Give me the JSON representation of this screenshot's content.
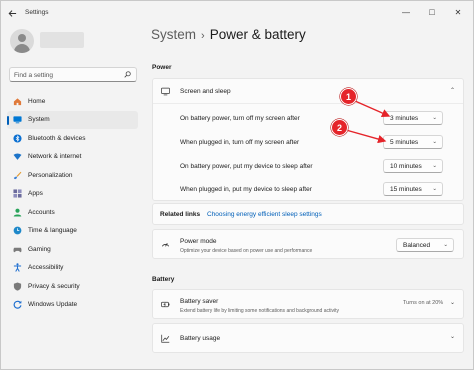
{
  "app": {
    "title": "Settings"
  },
  "window_controls": {
    "minimize": "—",
    "maximize": "□",
    "close": "✕"
  },
  "search": {
    "placeholder": "Find a setting"
  },
  "sidebar": {
    "items": [
      {
        "label": "Home",
        "icon": "home-icon",
        "color": "#e07a3a"
      },
      {
        "label": "System",
        "icon": "system-icon",
        "color": "#0078d4"
      },
      {
        "label": "Bluetooth & devices",
        "icon": "bluetooth-icon",
        "color": "#0a6fd1"
      },
      {
        "label": "Network & internet",
        "icon": "wifi-icon",
        "color": "#1d74c9"
      },
      {
        "label": "Personalization",
        "icon": "brush-icon",
        "color": "#e39b32"
      },
      {
        "label": "Apps",
        "icon": "apps-icon",
        "color": "#6b6b9c"
      },
      {
        "label": "Accounts",
        "icon": "accounts-icon",
        "color": "#28a35a"
      },
      {
        "label": "Time & language",
        "icon": "globe-clock-icon",
        "color": "#1e88c9"
      },
      {
        "label": "Gaming",
        "icon": "gaming-icon",
        "color": "#7a7a7a"
      },
      {
        "label": "Accessibility",
        "icon": "accessibility-icon",
        "color": "#1f6fd0"
      },
      {
        "label": "Privacy & security",
        "icon": "shield-icon",
        "color": "#7a7a7a"
      },
      {
        "label": "Windows Update",
        "icon": "update-icon",
        "color": "#1e6fd0"
      }
    ]
  },
  "breadcrumb": {
    "parent": "System",
    "separator": "›",
    "current": "Power & battery"
  },
  "power": {
    "section_label": "Power",
    "screen_sleep": {
      "title": "Screen and sleep",
      "rows": [
        {
          "label": "On battery power, turn off my screen after",
          "value": "3 minutes"
        },
        {
          "label": "When plugged in, turn off my screen after",
          "value": "5 minutes"
        },
        {
          "label": "On battery power, put my device to sleep after",
          "value": "10 minutes"
        },
        {
          "label": "When plugged in, put my device to sleep after",
          "value": "15 minutes"
        }
      ]
    },
    "related": {
      "label": "Related links",
      "link": "Choosing energy efficient sleep settings"
    },
    "power_mode": {
      "title": "Power mode",
      "desc": "Optimize your device based on power use and performance",
      "value": "Balanced"
    }
  },
  "battery": {
    "section_label": "Battery",
    "saver": {
      "title": "Battery saver",
      "desc": "Extend battery life by limiting some notifications and background activity",
      "status": "Turns on at 20%"
    },
    "usage": {
      "title": "Battery usage"
    }
  },
  "annotations": [
    {
      "number": "1",
      "color": "#e5242a"
    },
    {
      "number": "2",
      "color": "#e5242a"
    }
  ]
}
